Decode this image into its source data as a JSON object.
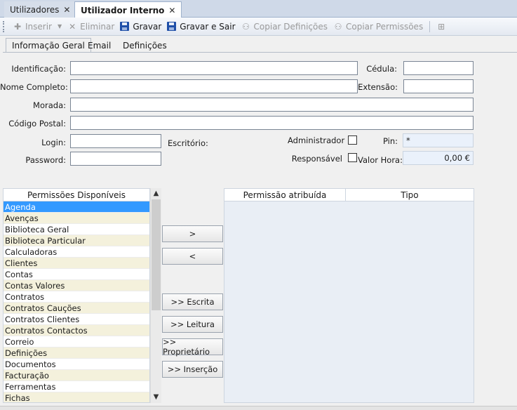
{
  "doc_tabs": [
    {
      "label": "Utilizadores",
      "close": "✕"
    },
    {
      "label": "Utilizador Interno",
      "close": "✕"
    }
  ],
  "toolbar": {
    "insert": "Inserir",
    "delete": "Eliminar",
    "save": "Gravar",
    "save_exit": "Gravar e Sair",
    "copy_definitions": "Copiar Definições",
    "copy_permissions": "Copiar Permissões"
  },
  "sub_tabs": [
    "Informação Geral",
    "Email",
    "Definições"
  ],
  "form": {
    "identificacao_label": "Identificação:",
    "cedula_label": "Cédula:",
    "nome_label": "Nome Completo:",
    "extensao_label": "Extensão:",
    "morada_label": "Morada:",
    "codigo_postal_label": "Código Postal:",
    "login_label": "Login:",
    "escritorio_label": "Escritório:",
    "administrador_label": "Administrador",
    "pin_label": "Pin:",
    "pin_value": "*",
    "password_label": "Password:",
    "responsavel_label": "Responsável",
    "valor_hora_label": "Valor Hora:",
    "valor_hora_value": "0,00 €"
  },
  "permissions": {
    "available_header": "Permissões Disponíveis",
    "items": [
      "Agenda",
      "Avenças",
      "Biblioteca Geral",
      "Biblioteca Particular",
      "Calculadoras",
      "Clientes",
      "Contas",
      "Contas Valores",
      "Contratos",
      "Contratos Cauções",
      "Contratos Clientes",
      "Contratos Contactos",
      "Correio",
      "Definições",
      "Documentos",
      "Facturação",
      "Ferramentas",
      "Fichas"
    ],
    "assigned_header": "Permissão atribuída",
    "type_header": "Tipo",
    "buttons": {
      "add": ">",
      "remove": "<",
      "write": ">> Escrita",
      "read": ">> Leitura",
      "owner": ">> Proprietário",
      "insert": ">> Inserção"
    }
  }
}
